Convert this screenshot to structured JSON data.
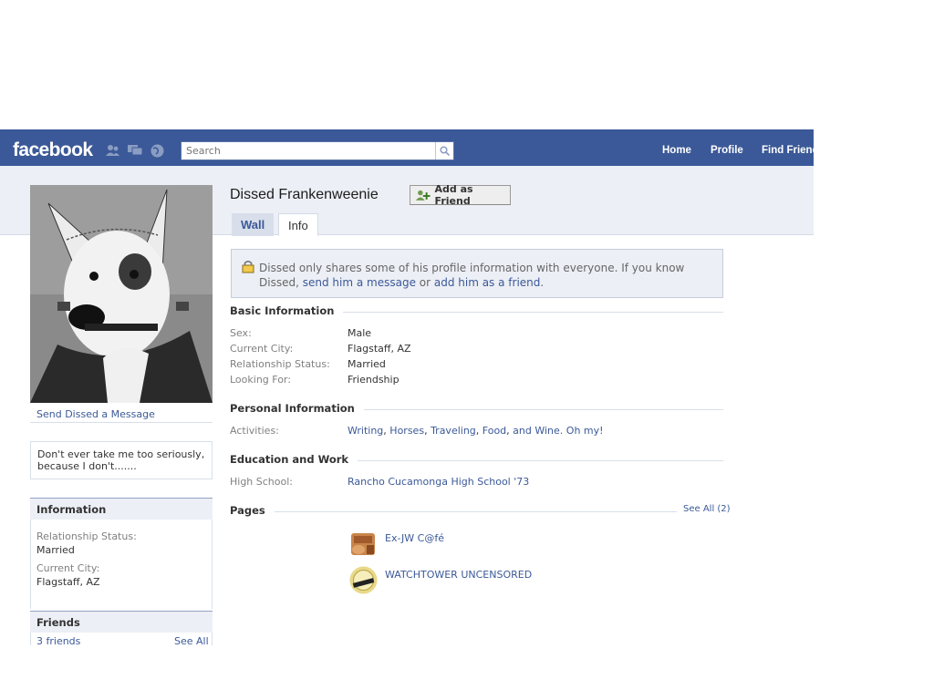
{
  "topbar": {
    "logo": "facebook",
    "search_placeholder": "Search",
    "nav": [
      "Home",
      "Profile",
      "Find Friends"
    ]
  },
  "profile": {
    "name": "Dissed Frankenweenie",
    "add_friend_label": "Add as Friend",
    "send_message": "Send Dissed a Message",
    "bio": "Don't ever take me too seriously, because I don't.......",
    "tabs": [
      "Wall",
      "Info"
    ],
    "active_tab": "Info"
  },
  "notice": {
    "text": "Dissed only shares some of his profile information with everyone. If you know Dissed,",
    "link1": "send him a message",
    "or": " or ",
    "link2": "add him as a friend",
    "end": "."
  },
  "sidebar": {
    "information": {
      "title": "Information",
      "relationship_label": "Relationship Status:",
      "relationship_value": "Married",
      "city_label": "Current City:",
      "city_value": "Flagstaff, AZ"
    },
    "friends": {
      "title": "Friends",
      "count": "3 friends",
      "see_all": "See All"
    }
  },
  "basic": {
    "title": "Basic Information",
    "rows": [
      {
        "label": "Sex:",
        "value": "Male"
      },
      {
        "label": "Current City:",
        "value": "Flagstaff, AZ"
      },
      {
        "label": "Relationship Status:",
        "value": "Married"
      },
      {
        "label": "Looking For:",
        "value": "Friendship"
      }
    ]
  },
  "personal": {
    "title": "Personal Information",
    "activities_label": "Activities:",
    "activities": [
      "Writing",
      "Horses",
      "Traveling",
      "Food",
      "and Wine. Oh my!"
    ]
  },
  "education": {
    "title": "Education and Work",
    "hs_label": "High School:",
    "hs_value": "Rancho Cucamonga High School '73"
  },
  "pages": {
    "title": "Pages",
    "see_all": "See All (2)",
    "items": [
      "Ex-JW C@fé",
      "WATCHTOWER UNCENSORED"
    ]
  },
  "colors": {
    "brand_blue": "#3b5998",
    "light_band": "#eceff5"
  }
}
